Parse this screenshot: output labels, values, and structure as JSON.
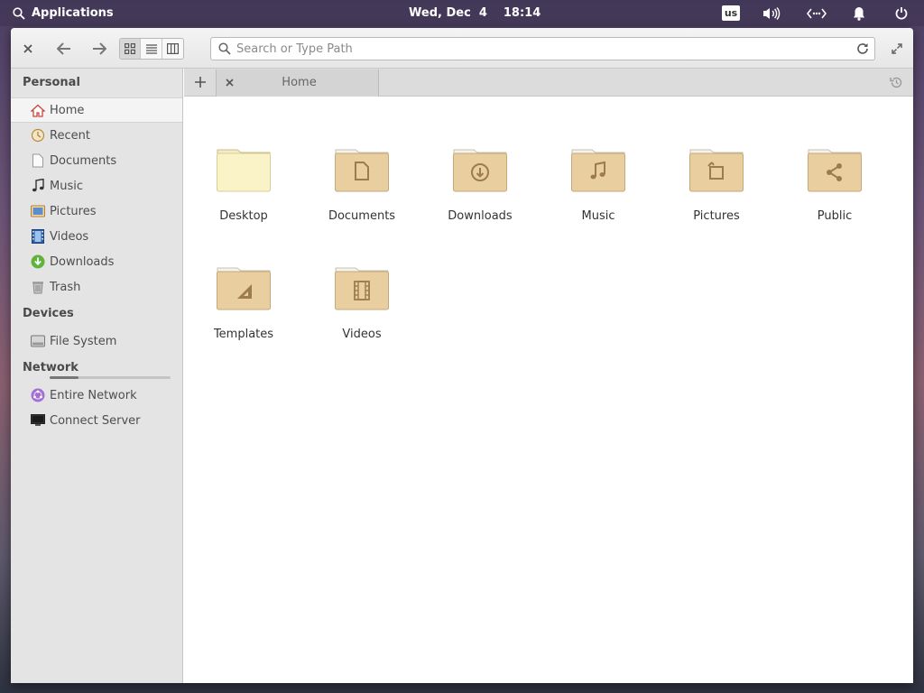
{
  "panel": {
    "applications_label": "Applications",
    "date": "Wed, Dec  4",
    "time": "18:14",
    "keyboard_layout": "us"
  },
  "toolbar": {
    "search_placeholder": "Search or Type Path"
  },
  "sidebar": {
    "personal_header": "Personal",
    "personal_items": [
      {
        "label": "Home",
        "icon": "home-icon"
      },
      {
        "label": "Recent",
        "icon": "recent-icon"
      },
      {
        "label": "Documents",
        "icon": "document-icon"
      },
      {
        "label": "Music",
        "icon": "music-icon"
      },
      {
        "label": "Pictures",
        "icon": "pictures-icon"
      },
      {
        "label": "Videos",
        "icon": "videos-icon"
      },
      {
        "label": "Downloads",
        "icon": "downloads-icon"
      },
      {
        "label": "Trash",
        "icon": "trash-icon"
      }
    ],
    "devices_header": "Devices",
    "devices_items": [
      {
        "label": "File System",
        "icon": "drive-icon",
        "usage_fraction": 0.24
      }
    ],
    "network_header": "Network",
    "network_items": [
      {
        "label": "Entire Network",
        "icon": "network-icon"
      },
      {
        "label": "Connect Server",
        "icon": "server-icon"
      }
    ]
  },
  "tabs": [
    {
      "title": "Home"
    }
  ],
  "folders": [
    {
      "name": "Desktop",
      "emblem": "desktop"
    },
    {
      "name": "Documents",
      "emblem": "document"
    },
    {
      "name": "Downloads",
      "emblem": "download"
    },
    {
      "name": "Music",
      "emblem": "music"
    },
    {
      "name": "Pictures",
      "emblem": "pictures"
    },
    {
      "name": "Public",
      "emblem": "share"
    },
    {
      "name": "Templates",
      "emblem": "templates"
    },
    {
      "name": "Videos",
      "emblem": "video"
    }
  ],
  "colors": {
    "folder_body": "#e9cfa0",
    "folder_emblem": "#9c7c4c",
    "desktop_folder": "#fbf3c8",
    "accent_home": "#d9534f"
  }
}
